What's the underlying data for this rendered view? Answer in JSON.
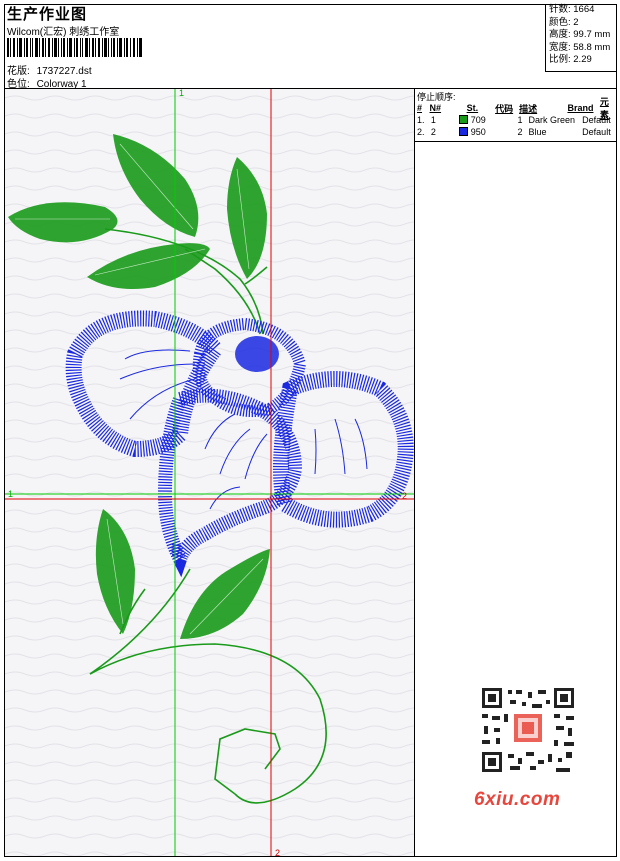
{
  "header": {
    "title": "生产作业图",
    "studio": "Wilcom(汇宏) 刺绣工作室",
    "pattern_label": "花版:",
    "pattern_value": "1737227.dst",
    "colorway_label": "色位:",
    "colorway_value": "Colorway 1"
  },
  "stats": {
    "stitches": "针数: 1664",
    "colors": "颜色: 2",
    "height": "高度: 99.7 mm",
    "width": "宽度: 58.8 mm",
    "scale": "比例: 2.29"
  },
  "stop_sequence": {
    "title": "停止顺序:",
    "headers": {
      "hash": "#",
      "n": "N#",
      "st": "St.",
      "code": "代码",
      "desc": "描述",
      "brand": "Brand",
      "element": "元素"
    },
    "rows": [
      {
        "hash": "1.",
        "n": "1",
        "color": "#1a9a1a",
        "st": "709",
        "code": "1",
        "desc": "Dark Green",
        "brand": "Default"
      },
      {
        "hash": "2.",
        "n": "2",
        "color": "#1a28e0",
        "st": "950",
        "code": "2",
        "desc": "Blue",
        "brand": "Default"
      }
    ]
  },
  "guides": {
    "green_top": "1",
    "green_left": "1",
    "red_right": "2",
    "red_bottom": "2"
  },
  "watermark": {
    "text": "6xiu.com"
  },
  "colors": {
    "green": "#1a9a1a",
    "blue": "#1a28e0",
    "guide_green": "#00cc00",
    "guide_red": "#e00000"
  }
}
